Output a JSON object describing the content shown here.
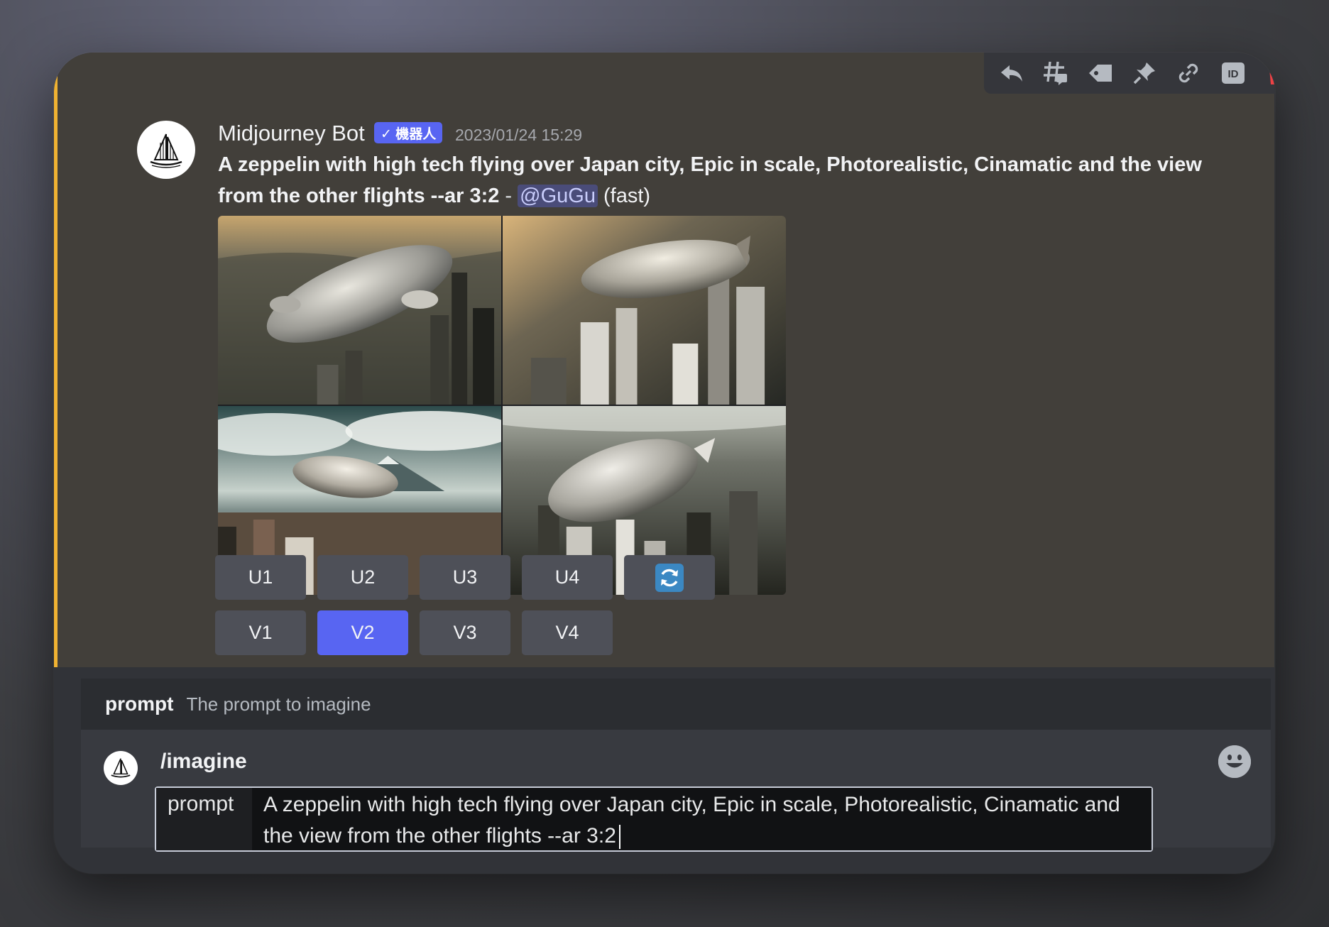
{
  "message": {
    "author": "Midjourney Bot",
    "badge": "✓ 機器人",
    "timestamp": "2023/01/24 15:29",
    "prompt_bold": "A zeppelin with high tech flying over Japan city, Epic in scale, Photorealistic, Cinamatic and the view from the other flights --ar 3:2",
    "separator": " - ",
    "mention": "@GuGu",
    "speed": " (fast)"
  },
  "toolbar": {
    "icons": [
      "reply-icon",
      "thread-icon",
      "tag-icon",
      "pin-icon",
      "link-icon",
      "id-icon",
      "trash-icon"
    ]
  },
  "images": [
    {
      "label": "zeppelin-image-1"
    },
    {
      "label": "zeppelin-image-2"
    },
    {
      "label": "zeppelin-image-3"
    },
    {
      "label": "zeppelin-image-4"
    }
  ],
  "buttons": {
    "upscale": [
      "U1",
      "U2",
      "U3",
      "U4"
    ],
    "variation": [
      "V1",
      "V2",
      "V3",
      "V4"
    ],
    "active": "V2",
    "reroll_icon": "refresh-icon"
  },
  "hint": {
    "name": "prompt",
    "description": "The prompt to imagine"
  },
  "composer": {
    "command": "/imagine",
    "option_label": "prompt",
    "option_value": "A zeppelin with high tech flying over Japan city, Epic in scale, Photorealistic, Cinamatic and the view from the other flights --ar 3:2"
  },
  "colors": {
    "accent": "#5865f2",
    "highlight_bar": "#f0b232",
    "danger": "#ed4245"
  }
}
